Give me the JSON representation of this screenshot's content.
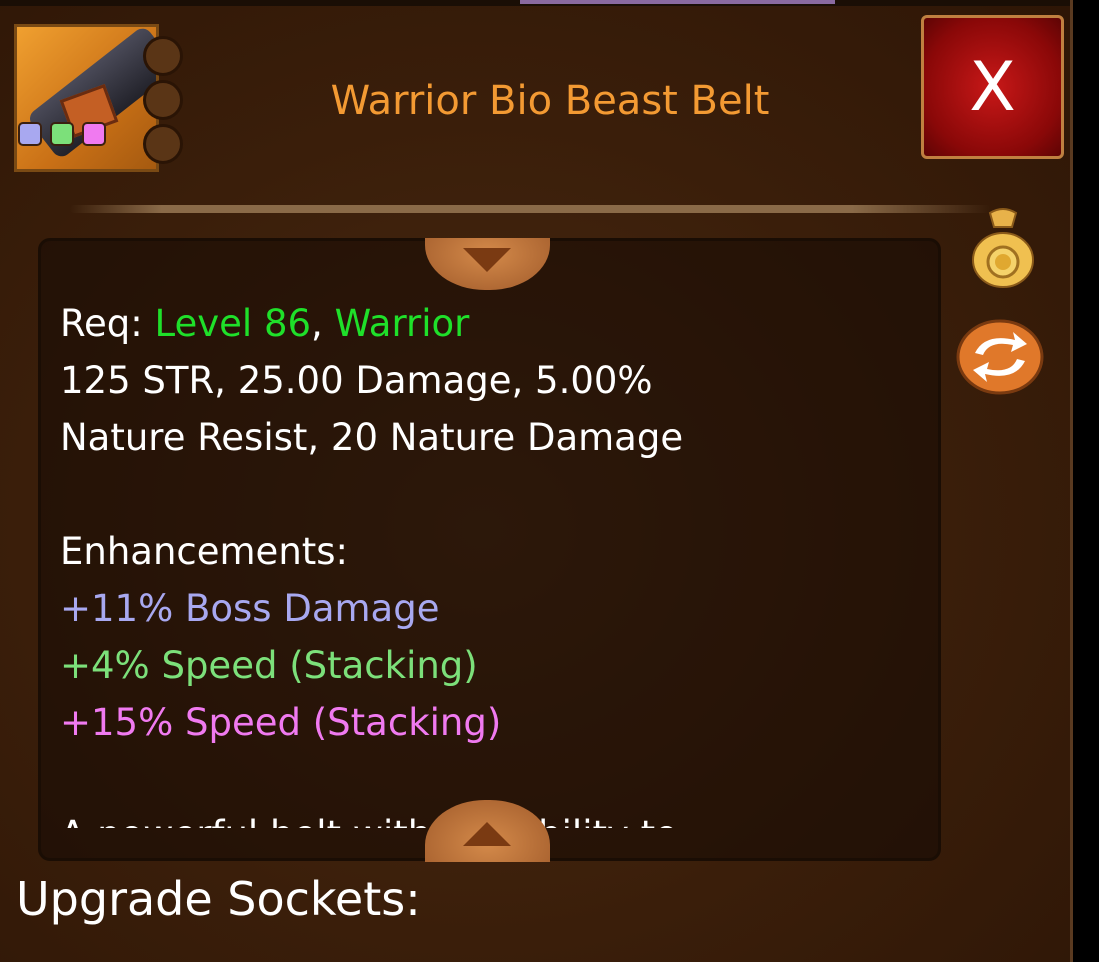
{
  "item": {
    "title": "Warrior Bio Beast Belt",
    "gem_colors": [
      "#a8a8f0",
      "#7ce07a",
      "#f07af0"
    ]
  },
  "close_label": "X",
  "requirements": {
    "prefix": "Req: ",
    "level": "Level 86",
    "separator": ", ",
    "class": "Warrior"
  },
  "stats": [
    "125 STR, 25.00 Damage, 5.00%",
    "Nature Resist, 20 Nature Damage"
  ],
  "enhancements": {
    "header": "Enhancements:",
    "items": [
      {
        "text": "+11% Boss Damage",
        "color": "#a8a8f0"
      },
      {
        "text": "+4% Speed (Stacking)",
        "color": "#7ce07a"
      },
      {
        "text": "+15% Speed (Stacking)",
        "color": "#f07af0"
      }
    ]
  },
  "description_partial": "A powerful belt with the ability to",
  "upgrade_sockets_label": "Upgrade Sockets:",
  "colors": {
    "title": "#f39a33",
    "requirement_green": "#1fe02a",
    "close_red": "#c81818"
  },
  "icons": [
    "belt-item-icon",
    "coin-bag-icon",
    "swap-arrows-icon",
    "scroll-up-arrow-icon",
    "scroll-down-arrow-icon"
  ]
}
